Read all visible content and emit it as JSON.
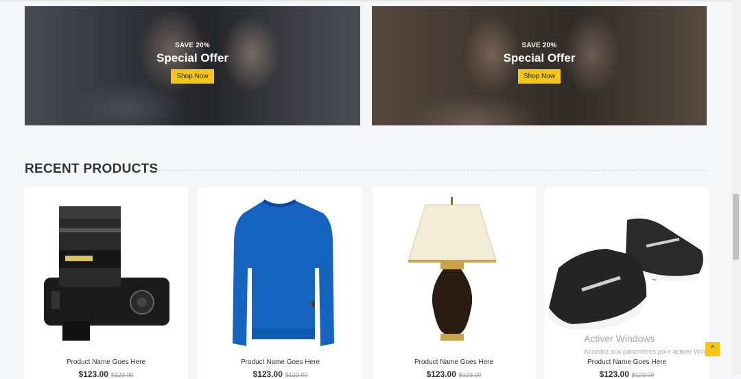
{
  "banners": [
    {
      "save": "SAVE 20%",
      "title": "Special Offer",
      "button": "Shop Now"
    },
    {
      "save": "SAVE 20%",
      "title": "Special Offer",
      "button": "Shop Now"
    }
  ],
  "recent": {
    "heading": "RECENT PRODUCTS",
    "products": [
      {
        "name": "Product Name Goes Here",
        "price": "$123.00",
        "old_price": "$123.00",
        "image": "camera"
      },
      {
        "name": "Product Name Goes Here",
        "price": "$123.00",
        "old_price": "$123.00",
        "image": "sweater"
      },
      {
        "name": "Product Name Goes Here",
        "price": "$123.00",
        "old_price": "$123.00",
        "image": "lamp"
      },
      {
        "name": "Product Name Goes Here",
        "price": "$123.00",
        "old_price": "$123.00",
        "image": "sneakers"
      }
    ]
  },
  "back_to_top_icon": "double-chevron-up-icon",
  "watermark": {
    "line1": "Activer Windows",
    "line2": "Accédez aux paramètres pour activer Windows."
  },
  "colors": {
    "accent": "#f5c518",
    "background": "#f5f6f8",
    "text": "#333333"
  }
}
